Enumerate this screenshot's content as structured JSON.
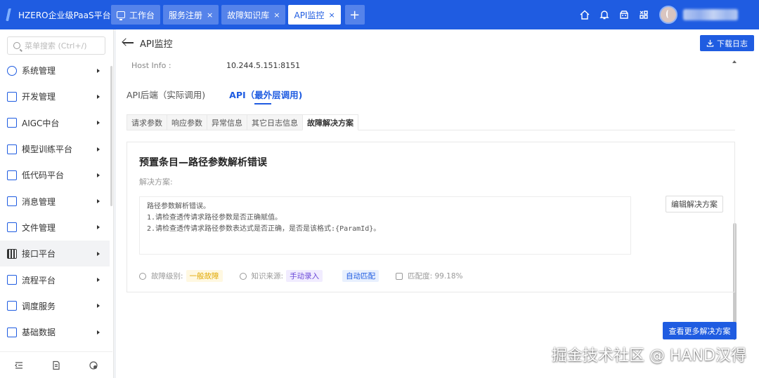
{
  "app": {
    "title": "HZERO企业级PaaS平台",
    "brand_color": "#1f5ce1"
  },
  "tabs": [
    {
      "label": "工作台",
      "icon": "monitor-icon",
      "closable": false,
      "active": false
    },
    {
      "label": "服务注册",
      "closable": true,
      "active": false
    },
    {
      "label": "故障知识库",
      "closable": true,
      "active": false
    },
    {
      "label": "API监控",
      "closable": true,
      "active": true
    }
  ],
  "tab_close_glyph": "×",
  "tab_add_glyph": "+",
  "topbar_icons": [
    "home-icon",
    "bell-icon",
    "cube-icon",
    "grid-icon",
    "avatar"
  ],
  "sidebar": {
    "search_placeholder": "菜单搜索 (Ctrl+/)",
    "items": [
      {
        "label": "系统管理",
        "icon": "system-icon"
      },
      {
        "label": "开发管理",
        "icon": "dev-icon"
      },
      {
        "label": "AIGC中台",
        "icon": "aigc-icon"
      },
      {
        "label": "模型训练平台",
        "icon": "model-icon"
      },
      {
        "label": "低代码平台",
        "icon": "lowcode-icon"
      },
      {
        "label": "消息管理",
        "icon": "message-icon"
      },
      {
        "label": "文件管理",
        "icon": "file-icon"
      },
      {
        "label": "接口平台",
        "icon": "interface-icon",
        "active": true
      },
      {
        "label": "流程平台",
        "icon": "flow-icon"
      },
      {
        "label": "调度服务",
        "icon": "schedule-icon"
      },
      {
        "label": "基础数据",
        "icon": "data-icon"
      }
    ],
    "footer_icons": [
      "collapse-icon",
      "document-icon",
      "settings-icon"
    ]
  },
  "page": {
    "title": "API监控",
    "download_label": "下载日志",
    "host_info_label": "Host Info :",
    "host_info_value": "10.244.5.151:8151",
    "api_tabs": [
      {
        "label": "API后端（实际调用)",
        "active": false
      },
      {
        "label": "API（最外层调用)",
        "active": true
      }
    ],
    "sub_tabs": [
      {
        "label": "请求参数",
        "active": false
      },
      {
        "label": "响应参数",
        "active": false
      },
      {
        "label": "异常信息",
        "active": false
      },
      {
        "label": "其它日志信息",
        "active": false
      },
      {
        "label": "故障解决方案",
        "active": true
      }
    ],
    "card": {
      "title": "预置条目—路径参数解析错误",
      "solution_label": "解决方案:",
      "solution_text": "路径参数解析错误。\n1.请检查透传请求路径参数是否正确赋值。\n2.请检查透传请求路径参数表达式是否正确，是否是该格式:{ParamId}。",
      "edit_label": "编辑解决方案",
      "meta": {
        "level_label": "故障级别:",
        "level_value": "一般故障",
        "source_label": "知识来源:",
        "source_value": "手动录入",
        "match_tag": "自动匹配",
        "match_label": "匹配度: 99.18%"
      }
    },
    "more_label": "查看更多解决方案"
  },
  "watermark": "掘金技术社区 @ HAND汉得"
}
